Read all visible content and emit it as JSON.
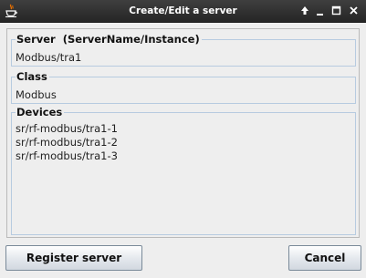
{
  "window": {
    "title": "Create/Edit a server",
    "controls": {
      "restore_icon": "up-arrow-icon",
      "minimize_icon": "minimize-icon",
      "maximize_icon": "maximize-icon",
      "close_icon": "close-icon"
    }
  },
  "server": {
    "label": "Server  (ServerName/Instance)",
    "value": "Modbus/tra1"
  },
  "class": {
    "label": "Class",
    "value": "Modbus"
  },
  "devices": {
    "label": "Devices",
    "items": [
      "sr/rf-modbus/tra1-1",
      "sr/rf-modbus/tra1-2",
      "sr/rf-modbus/tra1-3"
    ]
  },
  "buttons": {
    "register": "Register server",
    "cancel": "Cancel"
  },
  "colors": {
    "titlebar": "#2f2f2f",
    "background": "#eeeeee",
    "group_border": "#b7cbe0",
    "button_border": "#7a8a99"
  }
}
